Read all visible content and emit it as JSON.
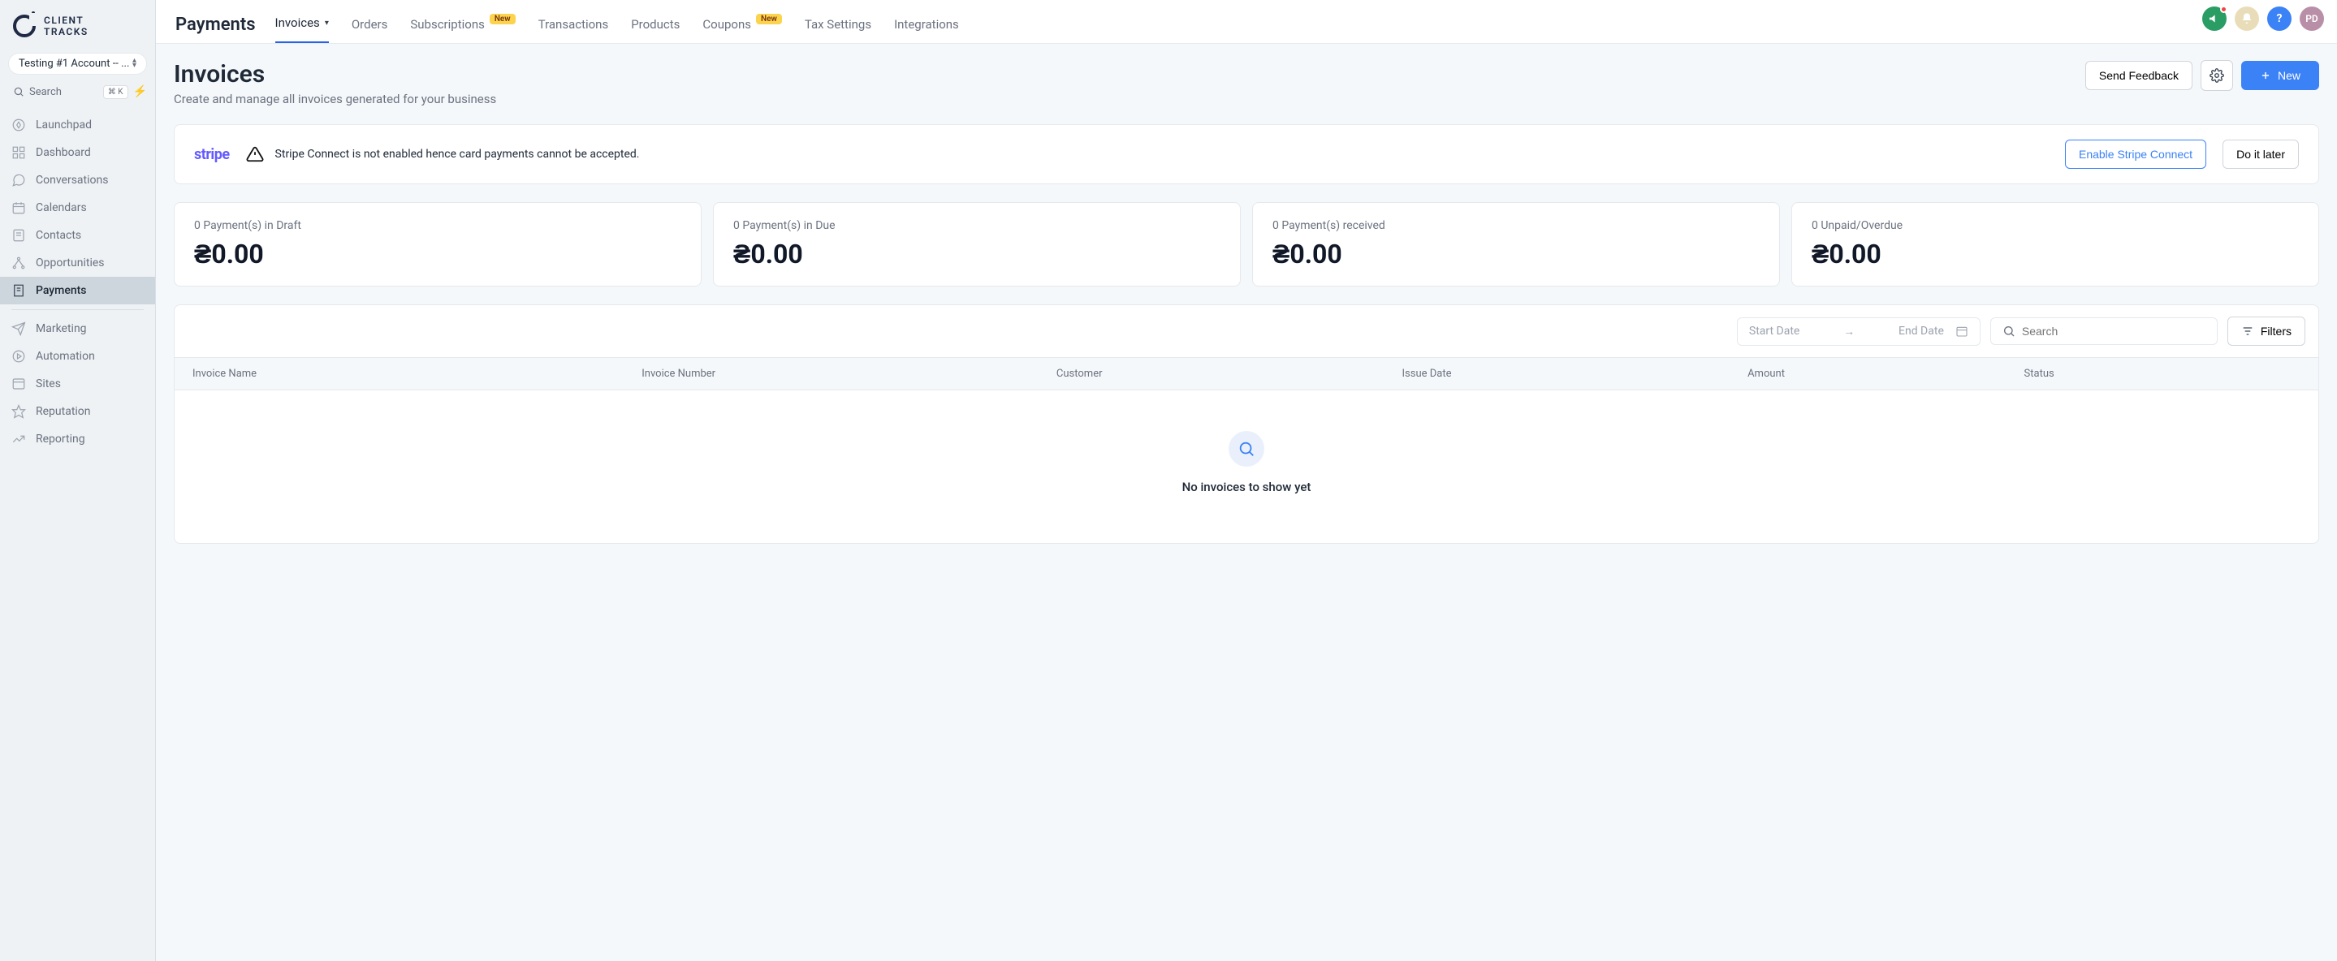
{
  "brand": {
    "line1": "CLIENT",
    "line2": "TRACKS"
  },
  "account_selector": "Testing #1 Account -- ...",
  "search_placeholder": "Search",
  "search_kbd": "⌘ K",
  "sidebar": {
    "items": [
      {
        "label": "Launchpad"
      },
      {
        "label": "Dashboard"
      },
      {
        "label": "Conversations"
      },
      {
        "label": "Calendars"
      },
      {
        "label": "Contacts"
      },
      {
        "label": "Opportunities"
      },
      {
        "label": "Payments",
        "active": true
      },
      {
        "label": "Marketing"
      },
      {
        "label": "Automation"
      },
      {
        "label": "Sites"
      },
      {
        "label": "Reputation"
      },
      {
        "label": "Reporting"
      }
    ]
  },
  "topbar_avatars": {
    "initials": "PD"
  },
  "section_heading": "Payments",
  "subtabs": [
    {
      "label": "Invoices",
      "active": true,
      "dropdown": true
    },
    {
      "label": "Orders"
    },
    {
      "label": "Subscriptions",
      "badge": "New"
    },
    {
      "label": "Transactions"
    },
    {
      "label": "Products"
    },
    {
      "label": "Coupons",
      "badge": "New"
    },
    {
      "label": "Tax Settings"
    },
    {
      "label": "Integrations"
    }
  ],
  "page": {
    "title": "Invoices",
    "subtitle": "Create and manage all invoices generated for your business",
    "send_feedback": "Send Feedback",
    "new_button": "New"
  },
  "alert": {
    "stripe": "stripe",
    "message": "Stripe Connect is not enabled hence card payments cannot be accepted.",
    "enable": "Enable Stripe Connect",
    "later": "Do it later"
  },
  "stats": [
    {
      "label": "0 Payment(s) in Draft",
      "value": "₴0.00"
    },
    {
      "label": "0 Payment(s) in Due",
      "value": "₴0.00"
    },
    {
      "label": "0 Payment(s) received",
      "value": "₴0.00"
    },
    {
      "label": "0 Unpaid/Overdue",
      "value": "₴0.00"
    }
  ],
  "toolbar": {
    "start_date": "Start Date",
    "end_date": "End Date",
    "search": "Search",
    "filters": "Filters"
  },
  "table": {
    "columns": [
      "Invoice Name",
      "Invoice Number",
      "Customer",
      "Issue Date",
      "Amount",
      "Status"
    ]
  },
  "empty_state": "No invoices to show yet"
}
